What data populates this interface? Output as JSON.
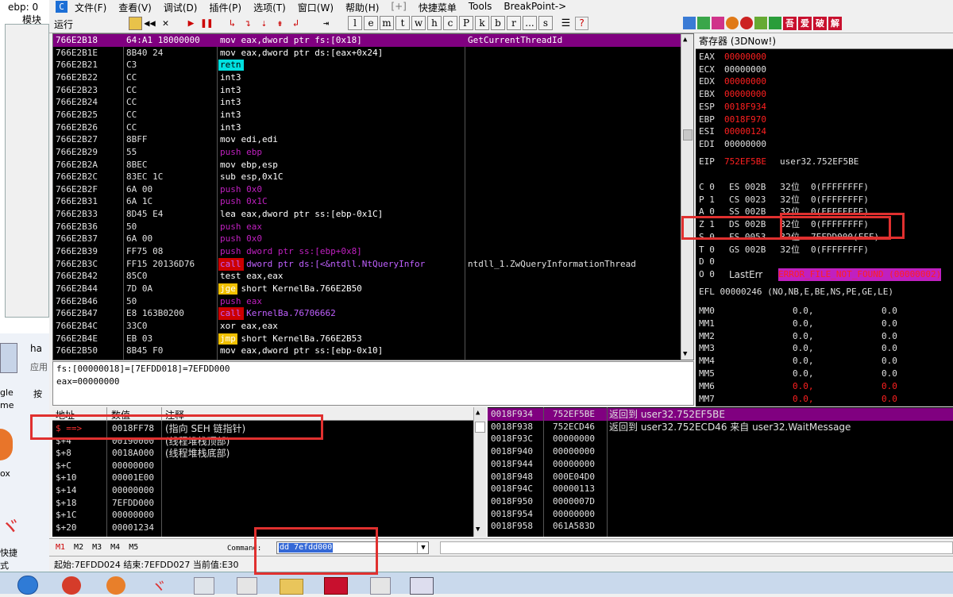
{
  "menu": {
    "items": [
      "文件(F)",
      "查看(V)",
      "调试(D)",
      "插件(P)",
      "选项(T)",
      "窗口(W)",
      "帮助(H)",
      "[+]",
      "快捷菜单",
      "Tools",
      "BreakPoint->"
    ],
    "app_letter": "C"
  },
  "toolbar": {
    "status": "运行",
    "letters": [
      "l",
      "e",
      "m",
      "t",
      "w",
      "h",
      "c",
      "P",
      "k",
      "b",
      "r",
      "...",
      "s"
    ],
    "right_icons": [
      "吾",
      "爱",
      "破",
      "解"
    ]
  },
  "disasm": {
    "rows": [
      {
        "addr": "766E2B18",
        "hex": "64:A1 18000000",
        "asm": "mov eax,dword ptr fs:[0x18]",
        "cmt": "GetCurrentThreadId"
      },
      {
        "addr": "766E2B1E",
        "hex": "8B40 24",
        "asm": "mov eax,dword ptr ds:[eax+0x24]",
        "cmt": ""
      },
      {
        "addr": "766E2B21",
        "hex": "C3",
        "asm": "retn",
        "cmt": ""
      },
      {
        "addr": "766E2B22",
        "hex": "CC",
        "asm": "int3",
        "cmt": ""
      },
      {
        "addr": "766E2B23",
        "hex": "CC",
        "asm": "int3",
        "cmt": ""
      },
      {
        "addr": "766E2B24",
        "hex": "CC",
        "asm": "int3",
        "cmt": ""
      },
      {
        "addr": "766E2B25",
        "hex": "CC",
        "asm": "int3",
        "cmt": ""
      },
      {
        "addr": "766E2B26",
        "hex": "CC",
        "asm": "int3",
        "cmt": ""
      },
      {
        "addr": "766E2B27",
        "hex": "8BFF",
        "asm": "mov edi,edi",
        "cmt": ""
      },
      {
        "addr": "766E2B29",
        "hex": "55",
        "asm": "push ebp",
        "cmt": ""
      },
      {
        "addr": "766E2B2A",
        "hex": "8BEC",
        "asm": "mov ebp,esp",
        "cmt": ""
      },
      {
        "addr": "766E2B2C",
        "hex": "83EC 1C",
        "asm": "sub esp,0x1C",
        "cmt": ""
      },
      {
        "addr": "766E2B2F",
        "hex": "6A 00",
        "asm": "push 0x0",
        "cmt": ""
      },
      {
        "addr": "766E2B31",
        "hex": "6A 1C",
        "asm": "push 0x1C",
        "cmt": ""
      },
      {
        "addr": "766E2B33",
        "hex": "8D45 E4",
        "asm": "lea eax,dword ptr ss:[ebp-0x1C]",
        "cmt": ""
      },
      {
        "addr": "766E2B36",
        "hex": "50",
        "asm": "push eax",
        "cmt": ""
      },
      {
        "addr": "766E2B37",
        "hex": "6A 00",
        "asm": "push 0x0",
        "cmt": ""
      },
      {
        "addr": "766E2B39",
        "hex": "FF75 08",
        "asm": "push dword ptr ss:[ebp+0x8]",
        "cmt": ""
      },
      {
        "addr": "766E2B3C",
        "hex": "FF15 20136D76",
        "asm": "call dword ptr ds:[<&ntdll.NtQueryInfor",
        "cmt": "ntdll_1.ZwQueryInformationThread"
      },
      {
        "addr": "766E2B42",
        "hex": "85C0",
        "asm": "test eax,eax",
        "cmt": ""
      },
      {
        "addr": "766E2B44",
        "hex": "7D 0A",
        "asm": "jge short KernelBa.766E2B50",
        "cmt": ""
      },
      {
        "addr": "766E2B46",
        "hex": "50",
        "asm": "push eax",
        "cmt": ""
      },
      {
        "addr": "766E2B47",
        "hex": "E8 163B0200",
        "asm": "call KernelBa.76706662",
        "cmt": ""
      },
      {
        "addr": "766E2B4C",
        "hex": "33C0",
        "asm": "xor eax,eax",
        "cmt": ""
      },
      {
        "addr": "766E2B4E",
        "hex": "EB 03",
        "asm": "jmp short KernelBa.766E2B53",
        "cmt": ""
      },
      {
        "addr": "766E2B50",
        "hex": "8B45 F0",
        "asm": "mov eax,dword ptr ss:[ebp-0x10]",
        "cmt": ""
      }
    ]
  },
  "info": {
    "line1": "fs:[00000018]=[7EFDD018]=7EFDD000",
    "line2": "eax=00000000"
  },
  "registers": {
    "title": "寄存器 (3DNow!)",
    "gp": [
      [
        "EAX",
        "00000000"
      ],
      [
        "ECX",
        "00000000"
      ],
      [
        "EDX",
        "00000000"
      ],
      [
        "EBX",
        "00000000"
      ],
      [
        "ESP",
        "0018F934"
      ],
      [
        "EBP",
        "0018F970"
      ],
      [
        "ESI",
        "00000124"
      ],
      [
        "EDI",
        "00000000"
      ]
    ],
    "eip": {
      "name": "EIP",
      "val": "752EF5BE",
      "sym": "user32.752EF5BE"
    },
    "segs": [
      {
        "flag": "C 0",
        "seg": "ES 002B",
        "bits": "32位",
        "base": "0(FFFFFFFF)"
      },
      {
        "flag": "P 1",
        "seg": "CS 0023",
        "bits": "32位",
        "base": "0(FFFFFFFF)"
      },
      {
        "flag": "A 0",
        "seg": "SS 002B",
        "bits": "32位",
        "base": "0(FFFFFFFF)"
      },
      {
        "flag": "Z 1",
        "seg": "DS 002B",
        "bits": "32位",
        "base": "0(FFFFFFFF)"
      },
      {
        "flag": "S 0",
        "seg": "FS 0053",
        "bits": "32位",
        "base": "7EFDD000(FFF)"
      },
      {
        "flag": "T 0",
        "seg": "GS 002B",
        "bits": "32位",
        "base": "0(FFFFFFFF)"
      }
    ],
    "d_flag": "D 0",
    "lasterr": {
      "flag": "O 0",
      "label": "LastErr",
      "val": "ERROR_FILE_NOT_FOUND (00000002)"
    },
    "efl": "EFL 00000246 (NO,NB,E,BE,NS,PE,GE,LE)",
    "mm": [
      [
        "MM0",
        "0.0,",
        "0.0"
      ],
      [
        "MM1",
        "0.0,",
        "0.0"
      ],
      [
        "MM2",
        "0.0,",
        "0.0"
      ],
      [
        "MM3",
        "0.0,",
        "0.0"
      ],
      [
        "MM4",
        "0.0,",
        "0.0"
      ],
      [
        "MM5",
        "0.0,",
        "0.0"
      ],
      [
        "MM6",
        "0.0,",
        "0.0"
      ],
      [
        "MM7",
        "0.0,",
        "0.0"
      ]
    ]
  },
  "dump": {
    "headers": [
      "地址",
      "数值",
      "注释"
    ],
    "rows": [
      {
        "addr": "$ ==>",
        "val": "0018FF78",
        "cmt": "(指向 SEH 链指针)"
      },
      {
        "addr": "$+4",
        "val": "00190000",
        "cmt": "(线程堆栈顶部)"
      },
      {
        "addr": "$+8",
        "val": "0018A000",
        "cmt": "(线程堆栈底部)"
      },
      {
        "addr": "$+C",
        "val": "00000000",
        "cmt": ""
      },
      {
        "addr": "$+10",
        "val": "00001E00",
        "cmt": ""
      },
      {
        "addr": "$+14",
        "val": "00000000",
        "cmt": ""
      },
      {
        "addr": "$+18",
        "val": "7EFDD000",
        "cmt": ""
      },
      {
        "addr": "$+1C",
        "val": "00000000",
        "cmt": ""
      },
      {
        "addr": "$+20",
        "val": "00001234",
        "cmt": ""
      }
    ]
  },
  "stack": {
    "rows": [
      {
        "addr": "0018F934",
        "val": "752EF5BE",
        "cmt": "返回到 user32.752EF5BE"
      },
      {
        "addr": "0018F938",
        "val": "752ECD46",
        "cmt": "返回到 user32.752ECD46 来自 user32.WaitMessage"
      },
      {
        "addr": "0018F93C",
        "val": "00000000",
        "cmt": ""
      },
      {
        "addr": "0018F940",
        "val": "00000000",
        "cmt": ""
      },
      {
        "addr": "0018F944",
        "val": "00000000",
        "cmt": ""
      },
      {
        "addr": "0018F948",
        "val": "000E04D0",
        "cmt": ""
      },
      {
        "addr": "0018F94C",
        "val": "00000113",
        "cmt": ""
      },
      {
        "addr": "0018F950",
        "val": "0000007D",
        "cmt": ""
      },
      {
        "addr": "0018F954",
        "val": "00000000",
        "cmt": ""
      },
      {
        "addr": "0018F958",
        "val": "061A583D",
        "cmt": ""
      }
    ]
  },
  "bottom": {
    "mtabs": [
      "M1",
      "M2",
      "M3",
      "M4",
      "M5"
    ],
    "command_label": "Command:",
    "command_value": "dd 7efdd000",
    "status": "起始:7EFDD024 结束:7EFDD027 当前值:E30"
  },
  "background": {
    "left_texts": [
      "ebp: 0",
      "模块",
      "ha",
      "应用",
      "gle",
      "me",
      "按",
      "ox",
      "快捷",
      "式"
    ]
  }
}
